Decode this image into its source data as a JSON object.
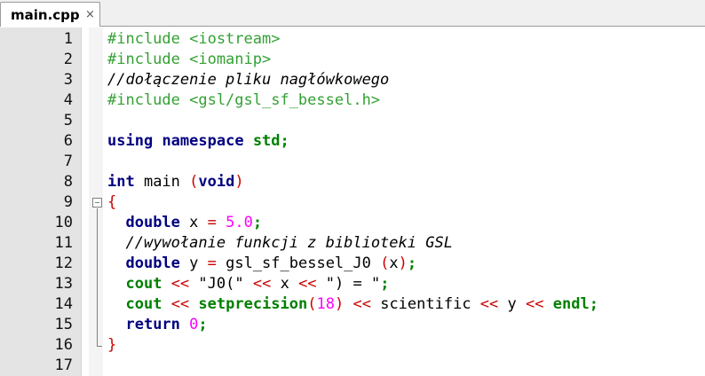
{
  "tab": {
    "label": "main.cpp",
    "close_glyph": "×"
  },
  "lines": [
    {
      "n": "1",
      "t": "#include <iostream>"
    },
    {
      "n": "2",
      "t": "#include <iomanip>"
    },
    {
      "n": "3",
      "t": "//dołączenie pliku nagłówkowego"
    },
    {
      "n": "4",
      "t": "#include <gsl/gsl_sf_bessel.h>"
    },
    {
      "n": "5",
      "t": ""
    },
    {
      "n": "6",
      "t": "using namespace std;"
    },
    {
      "n": "7",
      "t": ""
    },
    {
      "n": "8",
      "t": "int main (void)"
    },
    {
      "n": "9",
      "t": "{"
    },
    {
      "n": "10",
      "t": "  double x = 5.0;"
    },
    {
      "n": "11",
      "t": "  //wywołanie funkcji z biblioteki GSL"
    },
    {
      "n": "12",
      "t": "  double y = gsl_sf_bessel_J0 (x);"
    },
    {
      "n": "13",
      "t": "  cout << \"J0(\" << x << \") = \";"
    },
    {
      "n": "14",
      "t": "  cout << setprecision(18) << scientific << y << endl;"
    },
    {
      "n": "15",
      "t": "  return 0;"
    },
    {
      "n": "16",
      "t": "}"
    },
    {
      "n": "17",
      "t": ""
    }
  ],
  "colors": {
    "preprocessor": "#33a133",
    "keyword": "#000080",
    "stl": "#008000",
    "number": "#ff00ff",
    "brace": "#cc0000"
  }
}
